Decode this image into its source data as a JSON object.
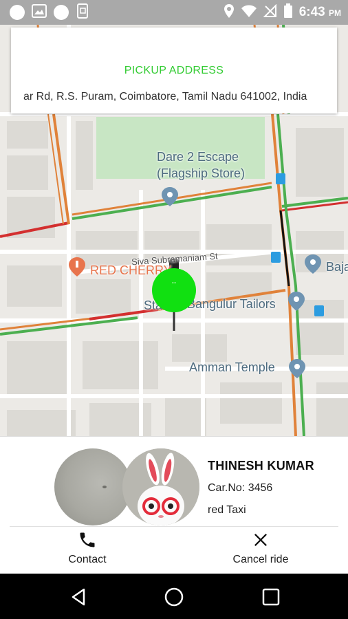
{
  "status_bar": {
    "time": "6:43",
    "ampm": "PM",
    "icons": [
      "notification-dot-icon",
      "image-icon",
      "notification-dot-icon",
      "screenshot-icon",
      "location-icon",
      "wifi-icon",
      "no-sim-icon",
      "battery-icon"
    ]
  },
  "pickup": {
    "title": "PICKUP ADDRESS",
    "address": "ar Rd, R.S. Puram, Coimbatore, Tamil Nadu 641002, India"
  },
  "map": {
    "labels": {
      "poi_dare_line1": "Dare 2 Escape",
      "poi_dare_line2": "(Flagship Store)",
      "poi_red_cherry": "RED CHERRY",
      "poi_bajaj": "Baja",
      "street_siva": "Siva Subramaniam St",
      "poi_tailors": "Sta",
      "poi_tailors_rest": "Bangulur Tailors",
      "poi_temple": "Amman Temple"
    },
    "marker_text": "--"
  },
  "driver": {
    "name": "THINESH KUMAR",
    "car_no": "Car.No: 3456",
    "car_type": "red Taxi"
  },
  "actions": {
    "contact_label": "Contact",
    "cancel_label": "Cancel ride"
  },
  "colors": {
    "pickup_title": "#33cc33",
    "marker": "#11e011",
    "traffic_green": "#4caf50",
    "traffic_orange": "#e0823a",
    "traffic_red": "#d32f2f"
  }
}
